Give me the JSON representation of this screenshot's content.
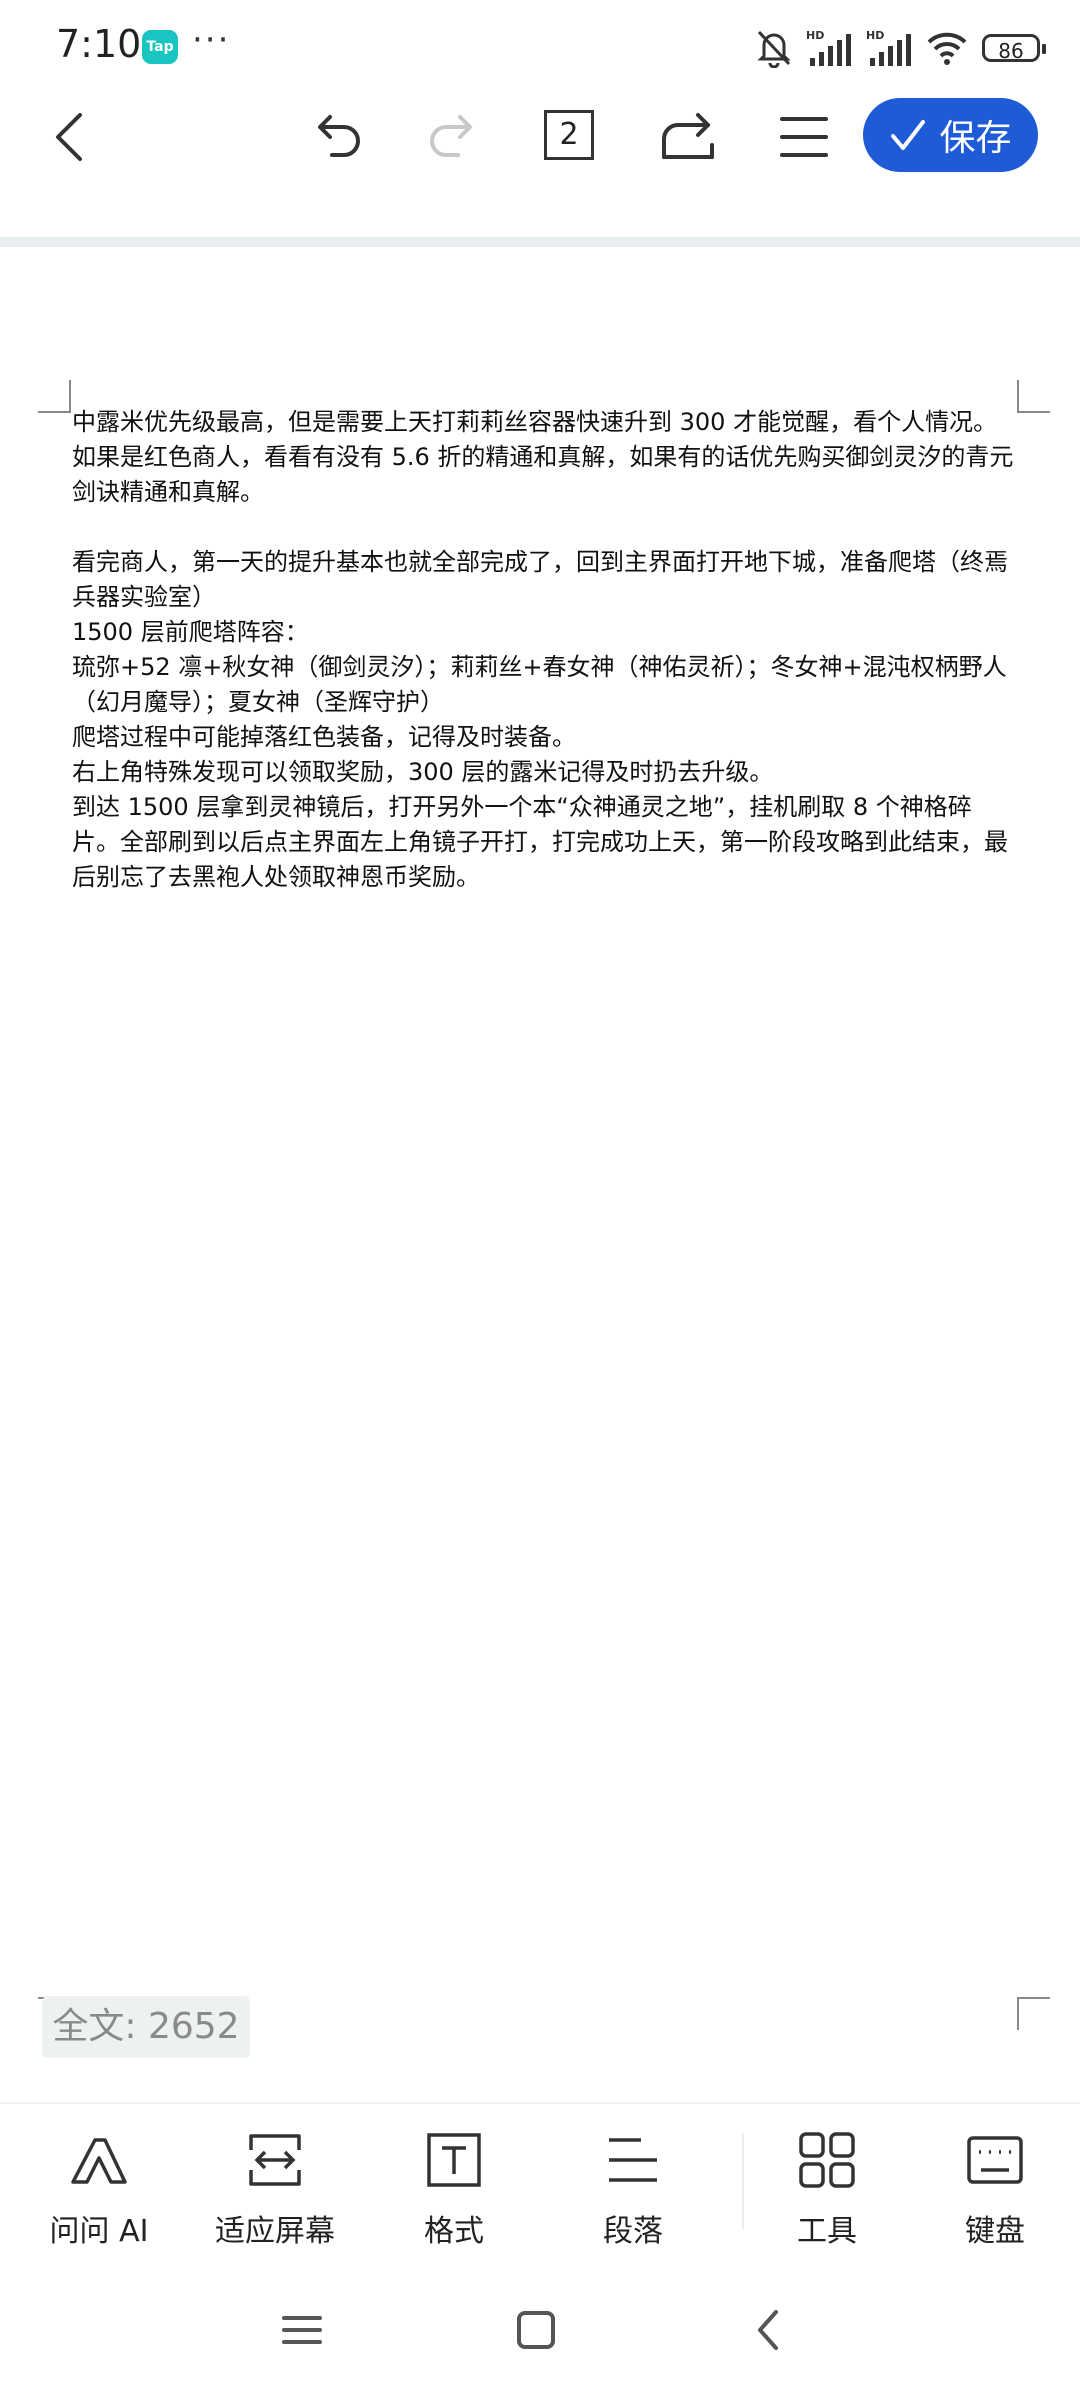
{
  "status_bar": {
    "time": "7:10",
    "tap_badge": "Tap",
    "more": "···",
    "battery": "86",
    "network_labels": [
      "HD",
      "HD"
    ],
    "icons": [
      "mute-bell-icon",
      "signal-icon",
      "signal-icon",
      "wifi-icon",
      "battery-icon"
    ]
  },
  "toolbar": {
    "page_count": "2",
    "save_label": "保存",
    "accent_color": "#1f5bd6"
  },
  "document": {
    "paragraphs": [
      "中露米优先级最高，但是需要上天打莉莉丝容器快速升到 300 才能觉醒，看个人情况。",
      "如果是红色商人，看看有没有 5.6 折的精通和真解，如果有的话优先购买御剑灵汐的青元剑诀精通和真解。",
      "",
      "看完商人，第一天的提升基本也就全部完成了，回到主界面打开地下城，准备爬塔（终焉兵器实验室）",
      "1500 层前爬塔阵容：",
      "琉弥+52 凛+秋女神（御剑灵汐）；莉莉丝+春女神（神佑灵祈）；冬女神+混沌权柄野人（幻月魔导）；夏女神（圣辉守护）",
      "爬塔过程中可能掉落红色装备，记得及时装备。",
      "右上角特殊发现可以领取奖励，300 层的露米记得及时扔去升级。",
      "到达 1500 层拿到灵神镜后，打开另外一个本“众神通灵之地”，挂机刷取 8 个神格碎片。全部刷到以后点主界面左上角镜子开打，打完成功上天，第一阶段攻略到此结束，最后别忘了去黑袍人处领取神恩币奖励。"
    ],
    "word_count": "全文: 2652"
  },
  "bottom_toolbar": {
    "items": [
      {
        "label": "问问 AI",
        "icon": "ai-icon"
      },
      {
        "label": "适应屏幕",
        "icon": "fit-screen-icon"
      },
      {
        "label": "格式",
        "icon": "format-icon"
      },
      {
        "label": "段落",
        "icon": "paragraph-icon"
      },
      {
        "label": "工具",
        "icon": "tools-icon"
      },
      {
        "label": "键盘",
        "icon": "keyboard-icon"
      }
    ]
  }
}
